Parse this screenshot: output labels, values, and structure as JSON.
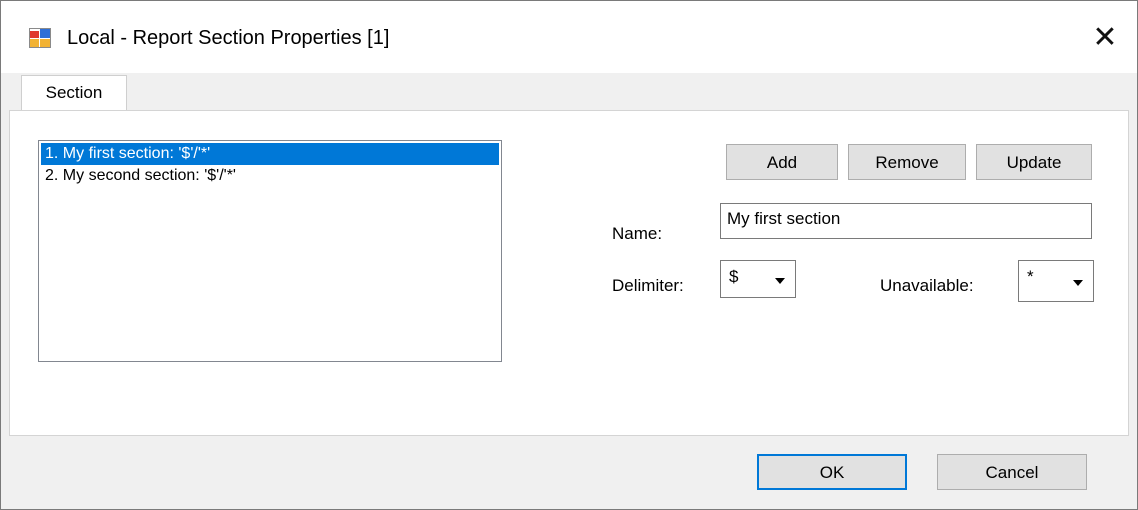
{
  "window": {
    "title": "Local - Report Section Properties [1]",
    "close_glyph": "✕"
  },
  "tabs": [
    {
      "label": "Section",
      "active": true
    }
  ],
  "sections_list": {
    "items": [
      {
        "label": "1. My first section: '$'/'*'",
        "selected": true
      },
      {
        "label": "2. My second section: '$'/'*'",
        "selected": false
      }
    ]
  },
  "actions": {
    "add_label": "Add",
    "remove_label": "Remove",
    "update_label": "Update"
  },
  "form": {
    "name_label": "Name:",
    "name_value": "My first section",
    "delimiter_label": "Delimiter:",
    "delimiter_value": "$",
    "unavailable_label": "Unavailable:",
    "unavailable_value": "*"
  },
  "footer": {
    "ok_label": "OK",
    "cancel_label": "Cancel"
  },
  "colors": {
    "selection": "#0078d7",
    "button_face": "#e1e1e1",
    "dialog_background": "#f0f0f0"
  },
  "icons": {
    "app": "report-window-icon",
    "close": "close-icon",
    "dropdown": "chevron-down-icon"
  }
}
